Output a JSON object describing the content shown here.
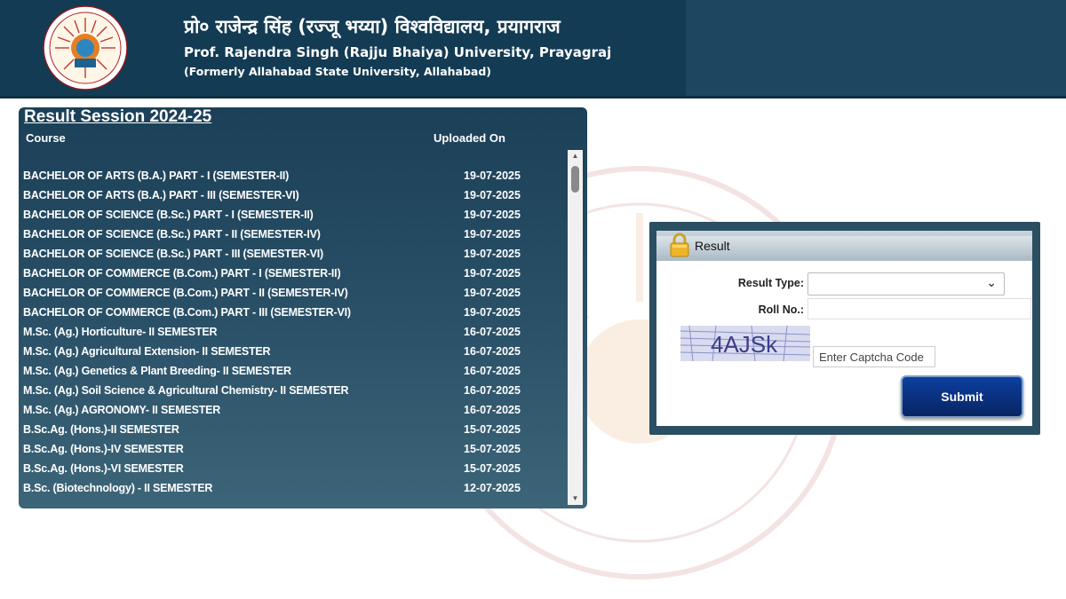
{
  "header": {
    "title_hindi": "प्रो० राजेन्द्र सिंह (रज्जू भय्या) विश्वविद्यालय, प्रयागराज",
    "title_english": "Prof. Rajendra Singh (Rajju Bhaiya) University, Prayagraj",
    "subtitle": "(Formerly Allahabad State University, Allahabad)"
  },
  "results": {
    "session_title": "Result Session 2024-25",
    "col_course": "Course",
    "col_uploaded": "Uploaded On",
    "rows": [
      {
        "course": "BACHELOR OF ARTS  (B.A.) PART - I (SEMESTER-II)",
        "date": "19-07-2025"
      },
      {
        "course": "BACHELOR OF ARTS  (B.A.) PART - III (SEMESTER-VI)",
        "date": "19-07-2025"
      },
      {
        "course": "BACHELOR OF SCIENCE  (B.Sc.) PART - I (SEMESTER-II)",
        "date": "19-07-2025"
      },
      {
        "course": "BACHELOR OF SCIENCE  (B.Sc.) PART - II (SEMESTER-IV)",
        "date": "19-07-2025"
      },
      {
        "course": "BACHELOR OF SCIENCE  (B.Sc.) PART - III (SEMESTER-VI)",
        "date": "19-07-2025"
      },
      {
        "course": "BACHELOR OF COMMERCE  (B.Com.) PART - I (SEMESTER-II)",
        "date": "19-07-2025"
      },
      {
        "course": "BACHELOR OF COMMERCE  (B.Com.) PART - II (SEMESTER-IV)",
        "date": "19-07-2025"
      },
      {
        "course": "BACHELOR OF COMMERCE  (B.Com.) PART - III (SEMESTER-VI)",
        "date": "19-07-2025"
      },
      {
        "course": "M.Sc. (Ag.) Horticulture- II SEMESTER",
        "date": "16-07-2025"
      },
      {
        "course": "M.Sc. (Ag.) Agricultural Extension- II SEMESTER",
        "date": "16-07-2025"
      },
      {
        "course": "M.Sc. (Ag.) Genetics & Plant Breeding- II SEMESTER",
        "date": "16-07-2025"
      },
      {
        "course": "M.Sc. (Ag.) Soil Science & Agricultural Chemistry- II SEMESTER",
        "date": "16-07-2025"
      },
      {
        "course": "M.Sc. (Ag.) AGRONOMY- II SEMESTER",
        "date": "16-07-2025"
      },
      {
        "course": "B.Sc.Ag. (Hons.)-II SEMESTER",
        "date": "15-07-2025"
      },
      {
        "course": "B.Sc.Ag. (Hons.)-IV SEMESTER",
        "date": "15-07-2025"
      },
      {
        "course": "B.Sc.Ag. (Hons.)-VI SEMESTER",
        "date": "15-07-2025"
      },
      {
        "course": "B.Sc. (Biotechnology) - II SEMESTER",
        "date": "12-07-2025"
      }
    ]
  },
  "form": {
    "title": "Result",
    "result_type_label": "Result Type:",
    "roll_label": "Roll No.:",
    "captcha_text": "4AJSk",
    "captcha_placeholder": "Enter Captcha Code",
    "submit_label": "Submit"
  },
  "colors": {
    "header_bg": "#133b54",
    "panel_bg": "#1b4058",
    "submit_bg": "#0a2f7a"
  }
}
